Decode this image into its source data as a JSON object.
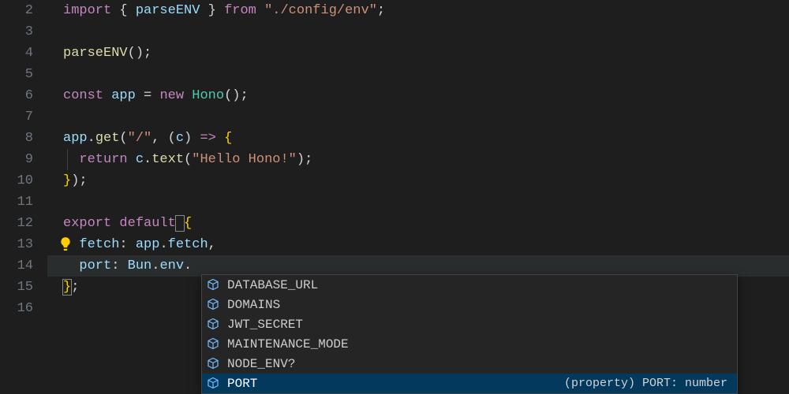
{
  "editor": {
    "firstLine": 2,
    "activeLine": 14,
    "lines": [
      {
        "tokens": [
          [
            "k",
            "import"
          ],
          [
            "p",
            " { "
          ],
          [
            "v",
            "parseENV"
          ],
          [
            "p",
            " } "
          ],
          [
            "k",
            "from"
          ],
          [
            "p",
            " "
          ],
          [
            "s",
            "\"./config/env\""
          ],
          [
            "p",
            ";"
          ]
        ]
      },
      {
        "tokens": []
      },
      {
        "tokens": [
          [
            "fn",
            "parseENV"
          ],
          [
            "p",
            "();"
          ]
        ]
      },
      {
        "tokens": []
      },
      {
        "tokens": [
          [
            "k",
            "const"
          ],
          [
            "p",
            " "
          ],
          [
            "v",
            "app"
          ],
          [
            "p",
            " = "
          ],
          [
            "k",
            "new"
          ],
          [
            "p",
            " "
          ],
          [
            "t",
            "Hono"
          ],
          [
            "p",
            "();"
          ]
        ]
      },
      {
        "tokens": []
      },
      {
        "tokens": [
          [
            "v",
            "app"
          ],
          [
            "p",
            "."
          ],
          [
            "fn",
            "get"
          ],
          [
            "p",
            "("
          ],
          [
            "s",
            "\"/\""
          ],
          [
            "p",
            ", ("
          ],
          [
            "v",
            "c"
          ],
          [
            "p",
            ") "
          ],
          [
            "k",
            "=>"
          ],
          [
            "p",
            " "
          ],
          [
            "br",
            "{"
          ]
        ]
      },
      {
        "tokens": [
          [
            "p",
            "  "
          ],
          [
            "k",
            "return"
          ],
          [
            "p",
            " "
          ],
          [
            "v",
            "c"
          ],
          [
            "p",
            "."
          ],
          [
            "fn",
            "text"
          ],
          [
            "p",
            "("
          ],
          [
            "s",
            "\"Hello Hono!\""
          ],
          [
            "p",
            ");"
          ]
        ],
        "guide": true
      },
      {
        "tokens": [
          [
            "br",
            "}"
          ],
          [
            "p",
            ");"
          ]
        ]
      },
      {
        "tokens": []
      },
      {
        "tokens": [
          [
            "k",
            "export"
          ],
          [
            "p",
            " "
          ],
          [
            "k",
            "default"
          ],
          [
            "p",
            " "
          ],
          [
            "br",
            "{"
          ]
        ],
        "braceMatch": 3
      },
      {
        "tokens": [
          [
            "p",
            "  "
          ],
          [
            "v",
            "fetch"
          ],
          [
            "p",
            ": "
          ],
          [
            "v",
            "app"
          ],
          [
            "p",
            "."
          ],
          [
            "v",
            "fetch"
          ],
          [
            "p",
            ","
          ]
        ],
        "bulb": true
      },
      {
        "tokens": [
          [
            "p",
            "  "
          ],
          [
            "v",
            "port"
          ],
          [
            "p",
            ": "
          ],
          [
            "v",
            "Bun"
          ],
          [
            "p",
            "."
          ],
          [
            "v",
            "env"
          ],
          [
            "p",
            "."
          ]
        ],
        "active": true
      },
      {
        "tokens": [
          [
            "br",
            "}"
          ],
          [
            "p",
            ";"
          ]
        ],
        "braceMatch": 0
      },
      {
        "tokens": []
      }
    ]
  },
  "suggest": {
    "items": [
      {
        "label": "DATABASE_URL",
        "kind": "field"
      },
      {
        "label": "DOMAINS",
        "kind": "field"
      },
      {
        "label": "JWT_SECRET",
        "kind": "field"
      },
      {
        "label": "MAINTENANCE_MODE",
        "kind": "field"
      },
      {
        "label": "NODE_ENV?",
        "kind": "field"
      },
      {
        "label": "PORT",
        "kind": "field",
        "selected": true,
        "detail": "(property) PORT: number"
      }
    ]
  },
  "icons": {
    "lightbulb_color": "#ffcc00",
    "field_color": "#75beff"
  }
}
